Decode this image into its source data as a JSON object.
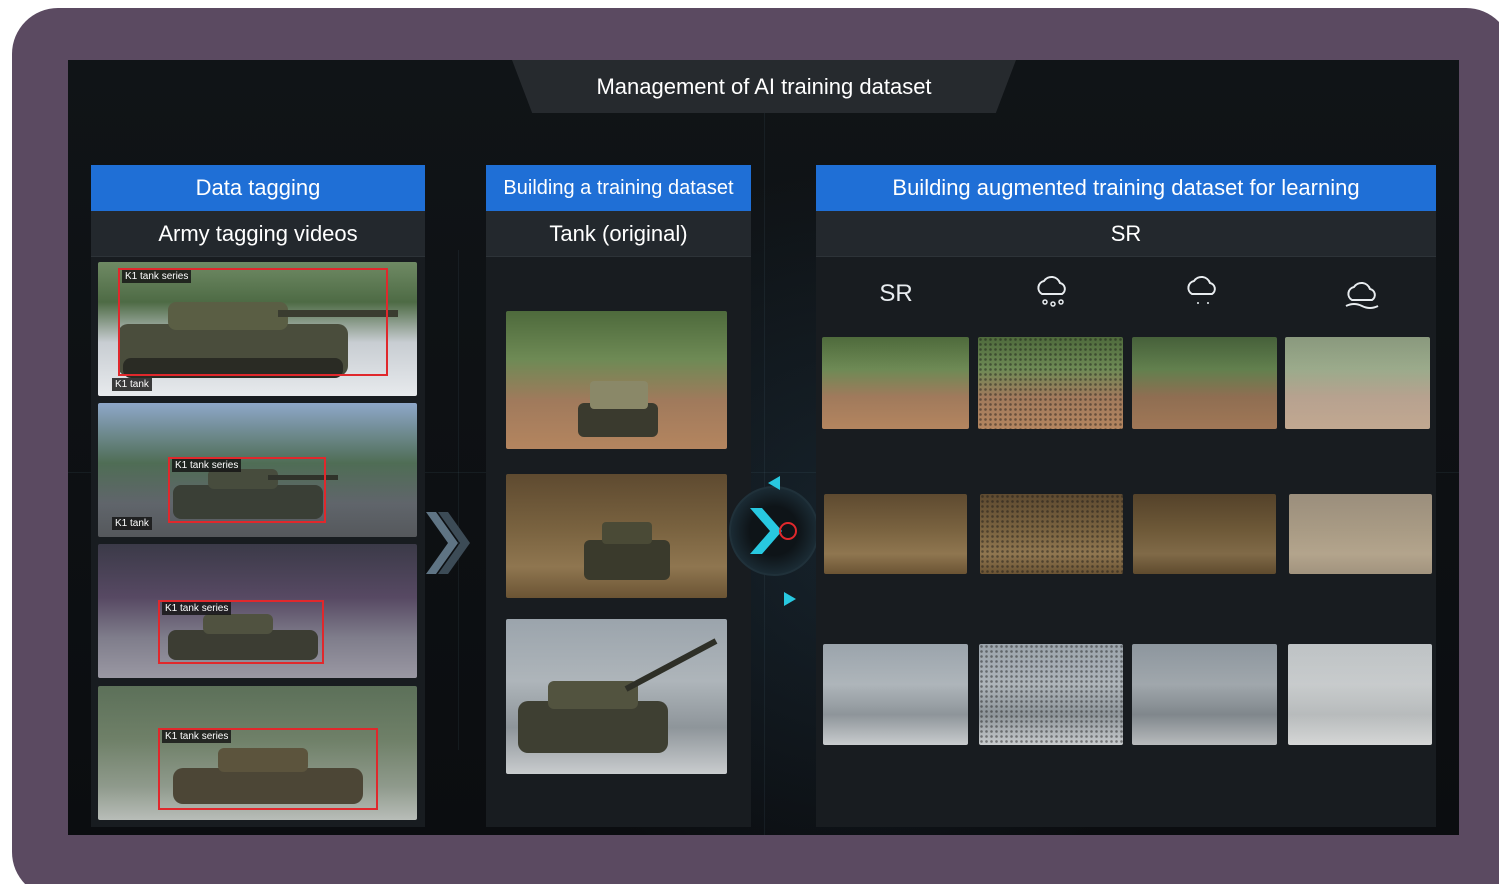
{
  "title": "Management of AI training dataset",
  "panels": {
    "tagging": {
      "header": "Data tagging",
      "subheader": "Army tagging videos",
      "tags": [
        {
          "label": "K1 tank series",
          "secondary": "K1 tank"
        },
        {
          "label": "K1 tank series",
          "secondary": "K1 tank"
        },
        {
          "label": "K1 tank series",
          "secondary": ""
        },
        {
          "label": "K1 tank series",
          "secondary": ""
        }
      ]
    },
    "training": {
      "header": "Building a training dataset",
      "subheader": "Tank (original)"
    },
    "augmented": {
      "header": "Building augmented training dataset for learning",
      "subheader": "SR",
      "columns": [
        {
          "label": "SR",
          "icon": ""
        },
        {
          "label": "",
          "icon": "cloud-hail-icon"
        },
        {
          "label": "",
          "icon": "cloud-drizzle-icon"
        },
        {
          "label": "",
          "icon": "cloud-fog-icon"
        }
      ]
    }
  },
  "colors": {
    "frame": "#5b4a61",
    "header_blue": "#1f6fd6",
    "tag_red": "#e0282c",
    "accent_cyan": "#28c8e0"
  }
}
